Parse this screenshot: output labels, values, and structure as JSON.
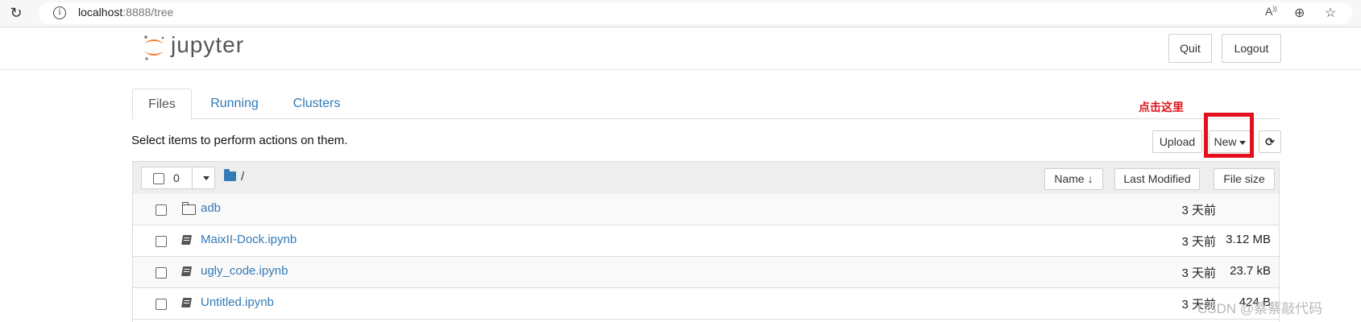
{
  "browser": {
    "url_host": "localhost",
    "url_rest": ":8888/tree"
  },
  "header": {
    "logo_text": "jupyter",
    "quit_label": "Quit",
    "logout_label": "Logout"
  },
  "tabs": [
    {
      "label": "Files"
    },
    {
      "label": "Running"
    },
    {
      "label": "Clusters"
    }
  ],
  "annotation": "点击这里",
  "toolbar": {
    "select_text": "Select items to perform actions on them.",
    "upload_label": "Upload",
    "new_label": "New"
  },
  "list": {
    "selected_count": "0",
    "breadcrumb": "/",
    "sort_name": "Name",
    "sort_modified": "Last Modified",
    "sort_size": "File size",
    "rows": [
      {
        "name": "adb",
        "type": "folder",
        "modified": "3 天前",
        "size": ""
      },
      {
        "name": "MaixII-Dock.ipynb",
        "type": "notebook",
        "modified": "3 天前",
        "size": "3.12 MB"
      },
      {
        "name": "ugly_code.ipynb",
        "type": "notebook",
        "modified": "3 天前",
        "size": "23.7 kB"
      },
      {
        "name": "Untitled.ipynb",
        "type": "notebook",
        "modified": "3 天前",
        "size": "424 B"
      }
    ]
  },
  "watermark": "CSDN @蔡蔡敲代码",
  "colors": {
    "link": "#337ab7",
    "annotation_red": "#e5101d",
    "logo_orange": "#f37726"
  }
}
